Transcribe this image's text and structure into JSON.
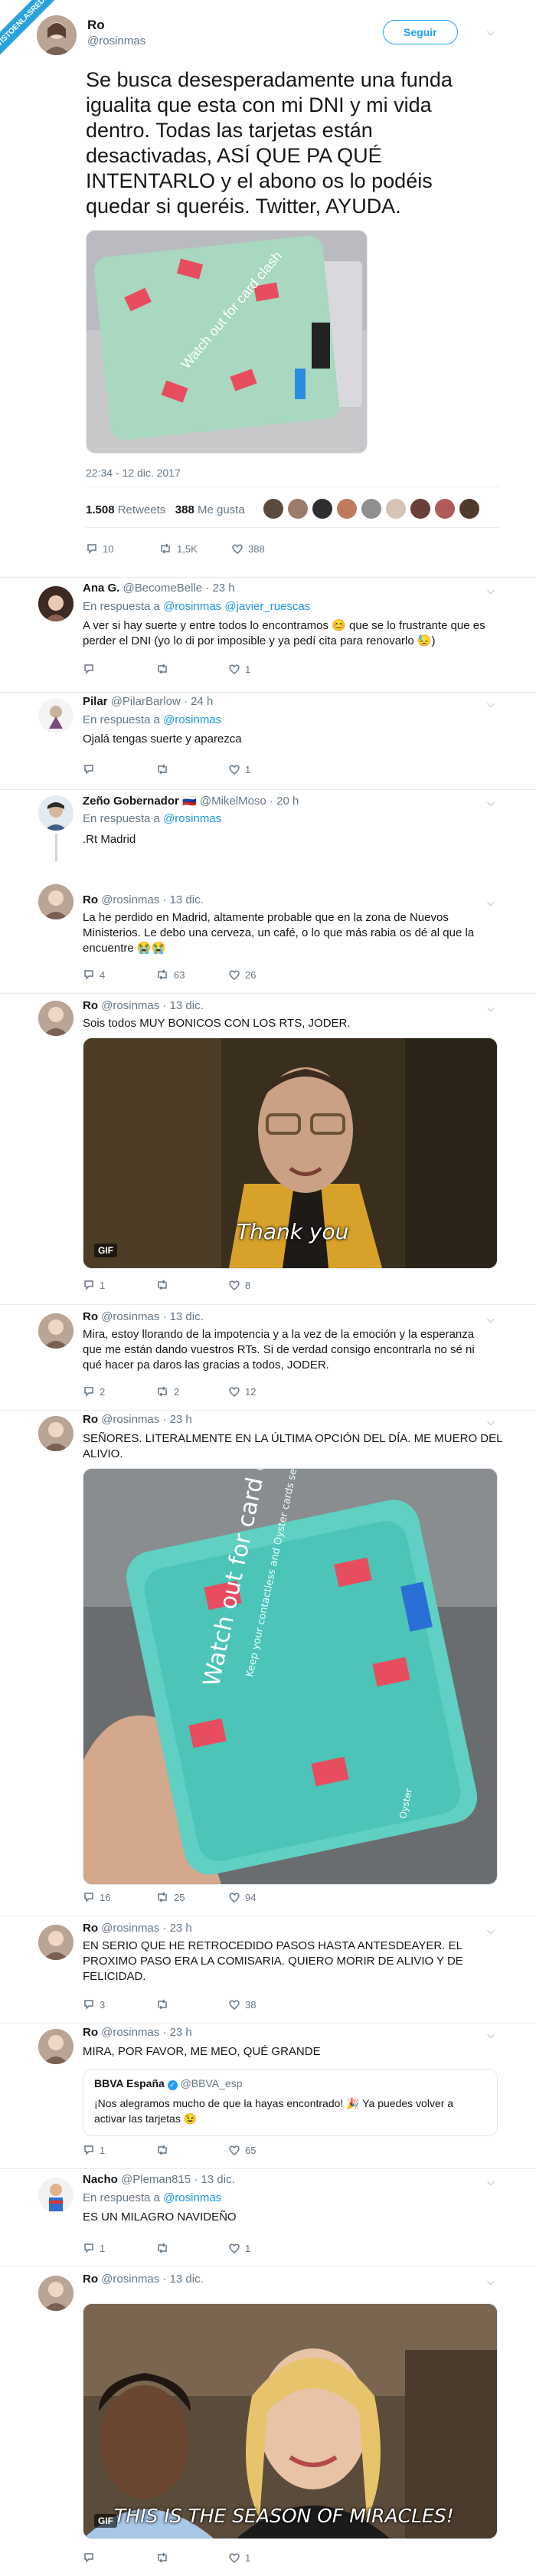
{
  "ribbon": "VISTOENLASREDES",
  "main": {
    "name": "Ro",
    "handle": "@rosinmas",
    "follow_label": "Seguir",
    "lines": [
      "Se busca desesperadamente una funda",
      "igualita que esta con mi DNI y mi vida",
      "dentro. Todas las tarjetas están",
      "desactivadas, ASÍ QUE PA QUÉ",
      "INTENTARLO y el abono os lo podéis",
      "quedar si queréis. Twitter, AYUDA."
    ],
    "time": "22:34 - 12 dic. 2017",
    "retweets_count": "1.508",
    "retweets_label": "Retweets",
    "likes_count": "388",
    "likes_label": "Me gusta",
    "reply_count": "10",
    "rt_count": "1,5K",
    "like_count": "388"
  },
  "replies": [
    {
      "name": "Ana G.",
      "handle": "@BecomeBelle · 23 h",
      "reply_prefix": "En respuesta a",
      "reply_to": "@rosinmas @javier_ruescas",
      "lines": [
        "A ver si hay suerte y entre todos lo encontramos 😊 que se lo frustrante que es",
        "perder el DNI (yo lo di por imposible y ya pedí cita para renovarlo 😓)"
      ],
      "reply": "",
      "rt": "",
      "like": "1"
    },
    {
      "name": "Pilar",
      "handle": "@PilarBarlow · 24 h",
      "reply_prefix": "En respuesta a",
      "reply_to": "@rosinmas",
      "lines": [
        "Ojalá tengas suerte y aparezca"
      ],
      "reply": "",
      "rt": "",
      "like": "1"
    },
    {
      "name": "Zeño Gobernador 🇷🇺",
      "handle": "@MikelMoso · 20 h",
      "reply_prefix": "En respuesta a",
      "reply_to": "@rosinmas",
      "lines": [
        ".Rt Madrid"
      ]
    },
    {
      "name": "Ro",
      "handle": "@rosinmas · 13 dic.",
      "lines": [
        "La he perdido en Madrid, altamente probable que en la zona de Nuevos",
        "Ministerios. Le debo una cerveza, un café, o lo que más rabia os dé al que la",
        "encuentre 😭😭"
      ],
      "reply": "4",
      "rt": "63",
      "like": "26"
    },
    {
      "name": "Ro",
      "handle": "@rosinmas · 13 dic.",
      "lines": [
        "Sois todos MUY BONICOS CON LOS RTS, JODER."
      ],
      "gif_caption": "Thank you",
      "gif_badge": "GIF",
      "reply": "1",
      "rt": "",
      "like": "8"
    },
    {
      "name": "Ro",
      "handle": "@rosinmas · 13 dic.",
      "lines": [
        "Mira, estoy llorando de la impotencia y a la vez de la emoción y la esperanza",
        "que me están dando vuestros RTs. Si de verdad consigo encontrarla no sé ni",
        "qué hacer pa daros las gracias a todos, JODER."
      ],
      "reply": "2",
      "rt": "2",
      "like": "12"
    },
    {
      "name": "Ro",
      "handle": "@rosinmas · 23 h",
      "lines": [
        "SEÑORES. LITERALMENTE EN LA ÚLTIMA OPCIÓN DEL DÍA. ME MUERO DEL",
        "ALIVIO."
      ],
      "reply": "16",
      "rt": "25",
      "like": "94"
    },
    {
      "name": "Ro",
      "handle": "@rosinmas · 23 h",
      "lines": [
        "EN SERIO QUE HE RETROCEDIDO PASOS HASTA ANTESDEAYER. EL",
        "PROXIMO PASO ERA LA COMISARIA. QUIERO MORIR DE ALIVIO Y DE",
        "FELICIDAD."
      ],
      "reply": "3",
      "rt": "",
      "like": "38"
    },
    {
      "name": "Ro",
      "handle": "@rosinmas · 23 h",
      "lines": [
        "MIRA, POR FAVOR, ME MEO, QUÉ GRANDE"
      ],
      "quote_name": "BBVA España",
      "quote_handle": "@BBVA_esp",
      "quote_lines": [
        "¡Nos alegramos mucho de que la hayas encontrado! 🎉 Ya puedes volver a",
        "activar las tarjetas 😉"
      ],
      "reply": "1",
      "rt": "",
      "like": "65"
    },
    {
      "name": "Nacho",
      "handle": "@Pleman815 · 13 dic.",
      "reply_prefix": "En respuesta a",
      "reply_to": "@rosinmas",
      "lines": [
        "ES UN MILAGRO NAVIDEÑO"
      ],
      "reply": "1",
      "rt": "",
      "like": "1"
    },
    {
      "name": "Ro",
      "handle": "@rosinmas · 13 dic.",
      "gif_caption": "THIS IS THE SEASON OF MIRACLES!",
      "gif_badge": "GIF",
      "reply": "",
      "rt": "",
      "like": "1"
    }
  ],
  "card_sleeve": {
    "main_text": "Watch out for card clash",
    "sub_text": "Keep your contactless and Oyster cards separate when touching in and out",
    "brand": "Oyster"
  }
}
